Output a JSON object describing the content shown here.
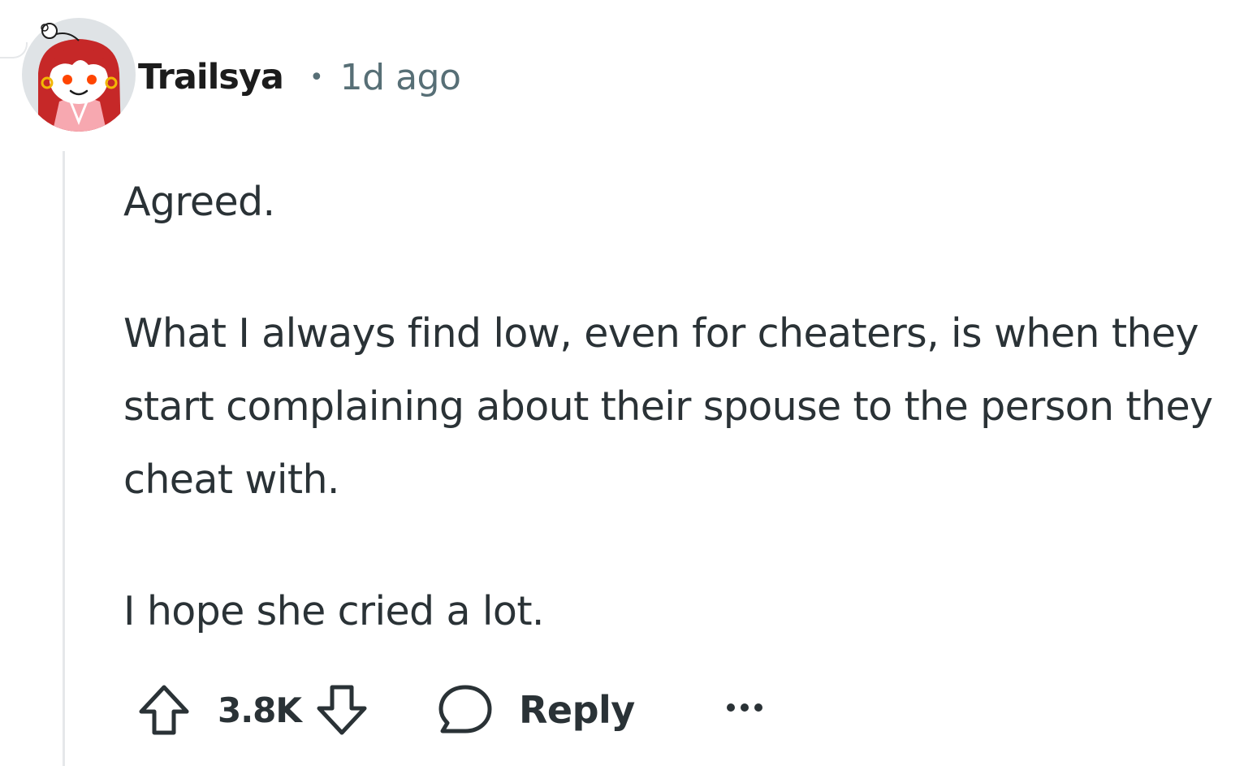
{
  "comment": {
    "author": "Trailsya",
    "separator": "•",
    "timestamp": "1d ago",
    "avatar_icon": "snoo-avatar-icon",
    "paragraphs": [
      "Agreed.",
      "What I always find low, even for cheaters, is when they start complaining about their spouse to the person they cheat with.",
      "I hope she cried a lot."
    ],
    "actions": {
      "upvote_icon": "upvote-arrow-icon",
      "score": "3.8K",
      "downvote_icon": "downvote-arrow-icon",
      "reply_icon": "speech-bubble-icon",
      "reply_label": "Reply",
      "more_icon": "overflow-dots-icon"
    }
  },
  "colors": {
    "text": "#2a3236",
    "meta": "#576f76",
    "thread_line": "#e6e8ea",
    "avatar_bg": "#dfe3e6",
    "avatar_hair": "#c62828",
    "avatar_dress": "#f7a8b0"
  }
}
